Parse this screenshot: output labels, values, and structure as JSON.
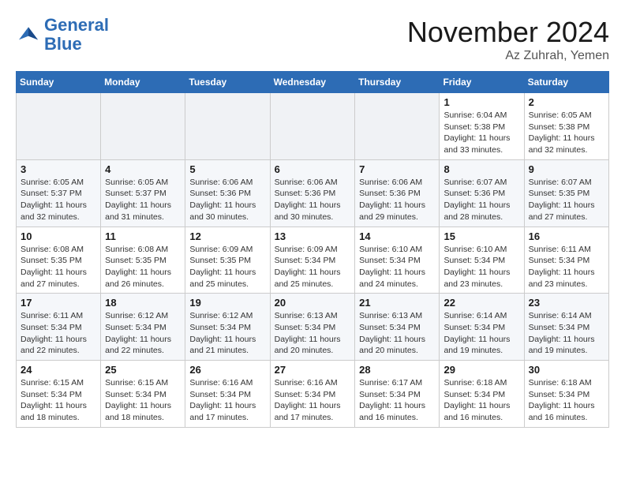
{
  "logo": {
    "line1": "General",
    "line2": "Blue"
  },
  "title": "November 2024",
  "location": "Az Zuhrah, Yemen",
  "weekdays": [
    "Sunday",
    "Monday",
    "Tuesday",
    "Wednesday",
    "Thursday",
    "Friday",
    "Saturday"
  ],
  "weeks": [
    [
      {
        "day": "",
        "info": ""
      },
      {
        "day": "",
        "info": ""
      },
      {
        "day": "",
        "info": ""
      },
      {
        "day": "",
        "info": ""
      },
      {
        "day": "",
        "info": ""
      },
      {
        "day": "1",
        "info": "Sunrise: 6:04 AM\nSunset: 5:38 PM\nDaylight: 11 hours\nand 33 minutes."
      },
      {
        "day": "2",
        "info": "Sunrise: 6:05 AM\nSunset: 5:38 PM\nDaylight: 11 hours\nand 32 minutes."
      }
    ],
    [
      {
        "day": "3",
        "info": "Sunrise: 6:05 AM\nSunset: 5:37 PM\nDaylight: 11 hours\nand 32 minutes."
      },
      {
        "day": "4",
        "info": "Sunrise: 6:05 AM\nSunset: 5:37 PM\nDaylight: 11 hours\nand 31 minutes."
      },
      {
        "day": "5",
        "info": "Sunrise: 6:06 AM\nSunset: 5:36 PM\nDaylight: 11 hours\nand 30 minutes."
      },
      {
        "day": "6",
        "info": "Sunrise: 6:06 AM\nSunset: 5:36 PM\nDaylight: 11 hours\nand 30 minutes."
      },
      {
        "day": "7",
        "info": "Sunrise: 6:06 AM\nSunset: 5:36 PM\nDaylight: 11 hours\nand 29 minutes."
      },
      {
        "day": "8",
        "info": "Sunrise: 6:07 AM\nSunset: 5:36 PM\nDaylight: 11 hours\nand 28 minutes."
      },
      {
        "day": "9",
        "info": "Sunrise: 6:07 AM\nSunset: 5:35 PM\nDaylight: 11 hours\nand 27 minutes."
      }
    ],
    [
      {
        "day": "10",
        "info": "Sunrise: 6:08 AM\nSunset: 5:35 PM\nDaylight: 11 hours\nand 27 minutes."
      },
      {
        "day": "11",
        "info": "Sunrise: 6:08 AM\nSunset: 5:35 PM\nDaylight: 11 hours\nand 26 minutes."
      },
      {
        "day": "12",
        "info": "Sunrise: 6:09 AM\nSunset: 5:35 PM\nDaylight: 11 hours\nand 25 minutes."
      },
      {
        "day": "13",
        "info": "Sunrise: 6:09 AM\nSunset: 5:34 PM\nDaylight: 11 hours\nand 25 minutes."
      },
      {
        "day": "14",
        "info": "Sunrise: 6:10 AM\nSunset: 5:34 PM\nDaylight: 11 hours\nand 24 minutes."
      },
      {
        "day": "15",
        "info": "Sunrise: 6:10 AM\nSunset: 5:34 PM\nDaylight: 11 hours\nand 23 minutes."
      },
      {
        "day": "16",
        "info": "Sunrise: 6:11 AM\nSunset: 5:34 PM\nDaylight: 11 hours\nand 23 minutes."
      }
    ],
    [
      {
        "day": "17",
        "info": "Sunrise: 6:11 AM\nSunset: 5:34 PM\nDaylight: 11 hours\nand 22 minutes."
      },
      {
        "day": "18",
        "info": "Sunrise: 6:12 AM\nSunset: 5:34 PM\nDaylight: 11 hours\nand 22 minutes."
      },
      {
        "day": "19",
        "info": "Sunrise: 6:12 AM\nSunset: 5:34 PM\nDaylight: 11 hours\nand 21 minutes."
      },
      {
        "day": "20",
        "info": "Sunrise: 6:13 AM\nSunset: 5:34 PM\nDaylight: 11 hours\nand 20 minutes."
      },
      {
        "day": "21",
        "info": "Sunrise: 6:13 AM\nSunset: 5:34 PM\nDaylight: 11 hours\nand 20 minutes."
      },
      {
        "day": "22",
        "info": "Sunrise: 6:14 AM\nSunset: 5:34 PM\nDaylight: 11 hours\nand 19 minutes."
      },
      {
        "day": "23",
        "info": "Sunrise: 6:14 AM\nSunset: 5:34 PM\nDaylight: 11 hours\nand 19 minutes."
      }
    ],
    [
      {
        "day": "24",
        "info": "Sunrise: 6:15 AM\nSunset: 5:34 PM\nDaylight: 11 hours\nand 18 minutes."
      },
      {
        "day": "25",
        "info": "Sunrise: 6:15 AM\nSunset: 5:34 PM\nDaylight: 11 hours\nand 18 minutes."
      },
      {
        "day": "26",
        "info": "Sunrise: 6:16 AM\nSunset: 5:34 PM\nDaylight: 11 hours\nand 17 minutes."
      },
      {
        "day": "27",
        "info": "Sunrise: 6:16 AM\nSunset: 5:34 PM\nDaylight: 11 hours\nand 17 minutes."
      },
      {
        "day": "28",
        "info": "Sunrise: 6:17 AM\nSunset: 5:34 PM\nDaylight: 11 hours\nand 16 minutes."
      },
      {
        "day": "29",
        "info": "Sunrise: 6:18 AM\nSunset: 5:34 PM\nDaylight: 11 hours\nand 16 minutes."
      },
      {
        "day": "30",
        "info": "Sunrise: 6:18 AM\nSunset: 5:34 PM\nDaylight: 11 hours\nand 16 minutes."
      }
    ]
  ]
}
